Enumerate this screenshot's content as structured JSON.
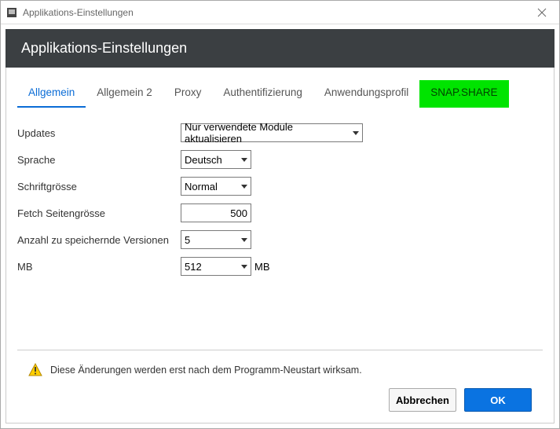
{
  "window": {
    "title": "Applikations-Einstellungen"
  },
  "header": {
    "title": "Applikations-Einstellungen"
  },
  "tabs": [
    {
      "label": "Allgemein",
      "active": true
    },
    {
      "label": "Allgemein 2"
    },
    {
      "label": "Proxy"
    },
    {
      "label": "Authentifizierung"
    },
    {
      "label": "Anwendungsprofil"
    },
    {
      "label": "SNAP.SHARE",
      "green": true
    }
  ],
  "form": {
    "updates": {
      "label": "Updates",
      "value": "Nur verwendete Module aktualisieren"
    },
    "language": {
      "label": "Sprache",
      "value": "Deutsch"
    },
    "fontsize": {
      "label": "Schriftgrösse",
      "value": "Normal"
    },
    "fetchPageSize": {
      "label": "Fetch Seitengrösse",
      "value": "500"
    },
    "versions": {
      "label": "Anzahl zu speichernde Versionen",
      "value": "5"
    },
    "mb": {
      "label": "MB",
      "value": "512",
      "suffix": "MB"
    }
  },
  "notice": {
    "text": "Diese Änderungen werden erst nach dem Programm-Neustart wirksam."
  },
  "buttons": {
    "cancel": "Abbrechen",
    "ok": "OK"
  }
}
